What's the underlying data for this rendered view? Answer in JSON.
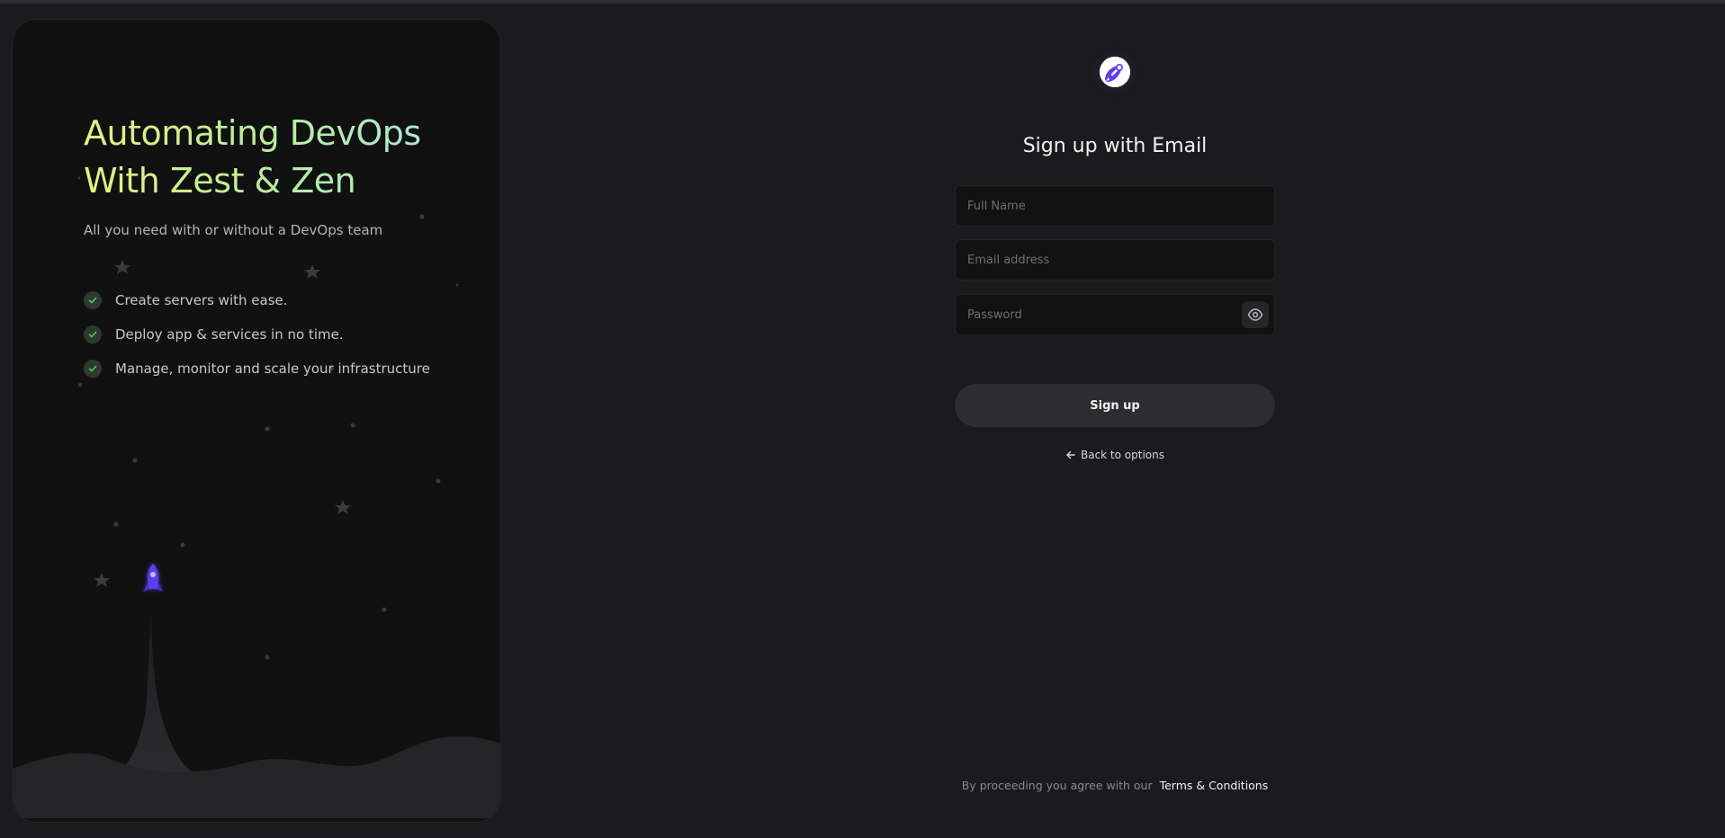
{
  "hero": {
    "title_line1": "Automating DevOps",
    "title_line2": "With Zest & Zen",
    "subtitle": "All you need with or without a DevOps team",
    "features": [
      "Create servers with ease.",
      "Deploy app & services in no time.",
      "Manage, monitor and scale your infrastructure"
    ],
    "check_icon": "check-icon",
    "accent_check": "#5ac46a"
  },
  "form": {
    "logo_icon": "rocket-icon",
    "title": "Sign up with Email",
    "full_name_placeholder": "Full Name",
    "full_name_value": "",
    "email_placeholder": "Email address",
    "email_value": "",
    "password_placeholder": "Password",
    "password_value": "",
    "password_toggle_icon": "eye-icon",
    "submit_label": "Sign up",
    "back_label": "Back to options",
    "back_icon": "arrow-left-icon"
  },
  "footer": {
    "legal_text": "By proceeding you agree with our",
    "terms_label": "Terms & Conditions"
  },
  "colors": {
    "background": "#1b1b1d",
    "panel": "#111112",
    "rocket_purple": "#5b3cf0",
    "button": "#2d2d30"
  }
}
